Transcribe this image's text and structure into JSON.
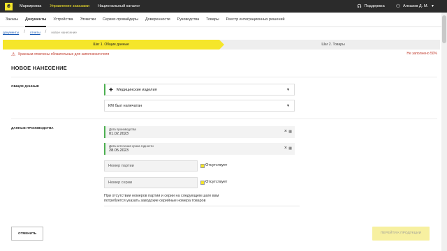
{
  "topbar": {
    "logo_glyph": "₴",
    "nav": [
      "Маркировка",
      "Управление заказами",
      "Национальный каталог"
    ],
    "active_index": 1,
    "support": "Поддержка",
    "user": "Алхазов Д. М.",
    "accent": "#f5e62a"
  },
  "subnav": {
    "items": [
      "Заказы",
      "Документы",
      "Устройства",
      "Этикетки",
      "Сервис-провайдеры",
      "Доверенности",
      "Руководства",
      "Товары",
      "Реестр интеграционных решений"
    ],
    "active_index": 1
  },
  "breadcrumbs": [
    "документы",
    "отчеты",
    "новое нанесение"
  ],
  "steps": {
    "step1": "Шаг 1. Общие данные",
    "step2": "Шаг 2. Товары"
  },
  "warning": "Красным отмечены обязательные для заполнения поля",
  "not_filled": "Не заполнено 50%",
  "page_title": "НОВОЕ НАНЕСЕНИЕ",
  "general": {
    "title": "ОБЩИЕ ДАННЫЕ",
    "product_group": "Медицинские изделия",
    "km_status": "КМ был напечатан"
  },
  "production": {
    "title": "ДАННЫЕ ПРОИЗВОДСТВА",
    "prod_date_label": "Дата производства",
    "prod_date": "01.02.2023",
    "exp_date_label": "Дата истечения срока годности",
    "exp_date": "28.05.2023",
    "batch_placeholder": "Номер партии",
    "batch_absent": "Отсутствует",
    "series_placeholder": "Номер серии",
    "series_absent": "Отсутствует",
    "hint": "При отсутствии номеров партии и серии на следующем шаге вам потребуется указать заводские серийные номера товаров"
  },
  "buttons": {
    "cancel": "ОТМЕНИТЬ",
    "next": "ПЕРЕЙТИ К ПРОДУКЦИИ"
  }
}
